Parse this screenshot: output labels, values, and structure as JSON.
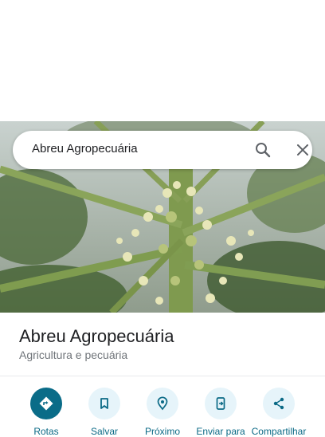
{
  "search": {
    "query": "Abreu Agropecuária",
    "search_icon": "search-icon",
    "close_icon": "close-icon"
  },
  "place": {
    "name": "Abreu Agropecuária",
    "category": "Agricultura e pecuária",
    "photo": "papaya-tree-photo"
  },
  "actions": [
    {
      "label": "Rotas",
      "icon": "directions-icon"
    },
    {
      "label": "Salvar",
      "icon": "bookmark-icon"
    },
    {
      "label": "Próximo",
      "icon": "nearby-icon"
    },
    {
      "label": "Enviar para",
      "icon": "send-to-phone-icon"
    },
    {
      "label": "Compartilhar",
      "icon": "share-icon"
    }
  ],
  "colors": {
    "accent": "#0a6c88",
    "action_bg": "#e6f4fa",
    "action_label": "#0b6a86",
    "title": "#202124",
    "subtitle": "#70757a"
  }
}
